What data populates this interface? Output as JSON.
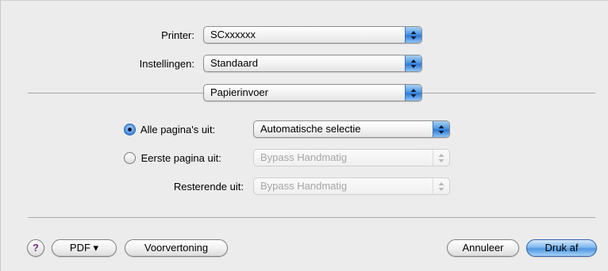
{
  "header": {
    "printer_label": "Printer:",
    "printer_value": "SCxxxxxx",
    "settings_label": "Instellingen:",
    "settings_value": "Standaard",
    "panel_value": "Papierinvoer"
  },
  "paper": {
    "all_pages_label": "Alle pagina's uit:",
    "all_pages_value": "Automatische selectie",
    "all_pages_selected": true,
    "first_page_label": "Eerste pagina uit:",
    "first_page_value": "Bypass Handmatig",
    "first_page_selected": false,
    "remaining_label": "Resterende uit:",
    "remaining_value": "Bypass Handmatig"
  },
  "footer": {
    "help_label": "?",
    "pdf_label": "PDF ▾",
    "preview_label": "Voorvertoning",
    "cancel_label": "Annuleer",
    "print_label": "Druk af"
  },
  "colors": {
    "accent": "#4f97e3",
    "background": "#ececec",
    "disabled_text": "#a6a6a6"
  }
}
